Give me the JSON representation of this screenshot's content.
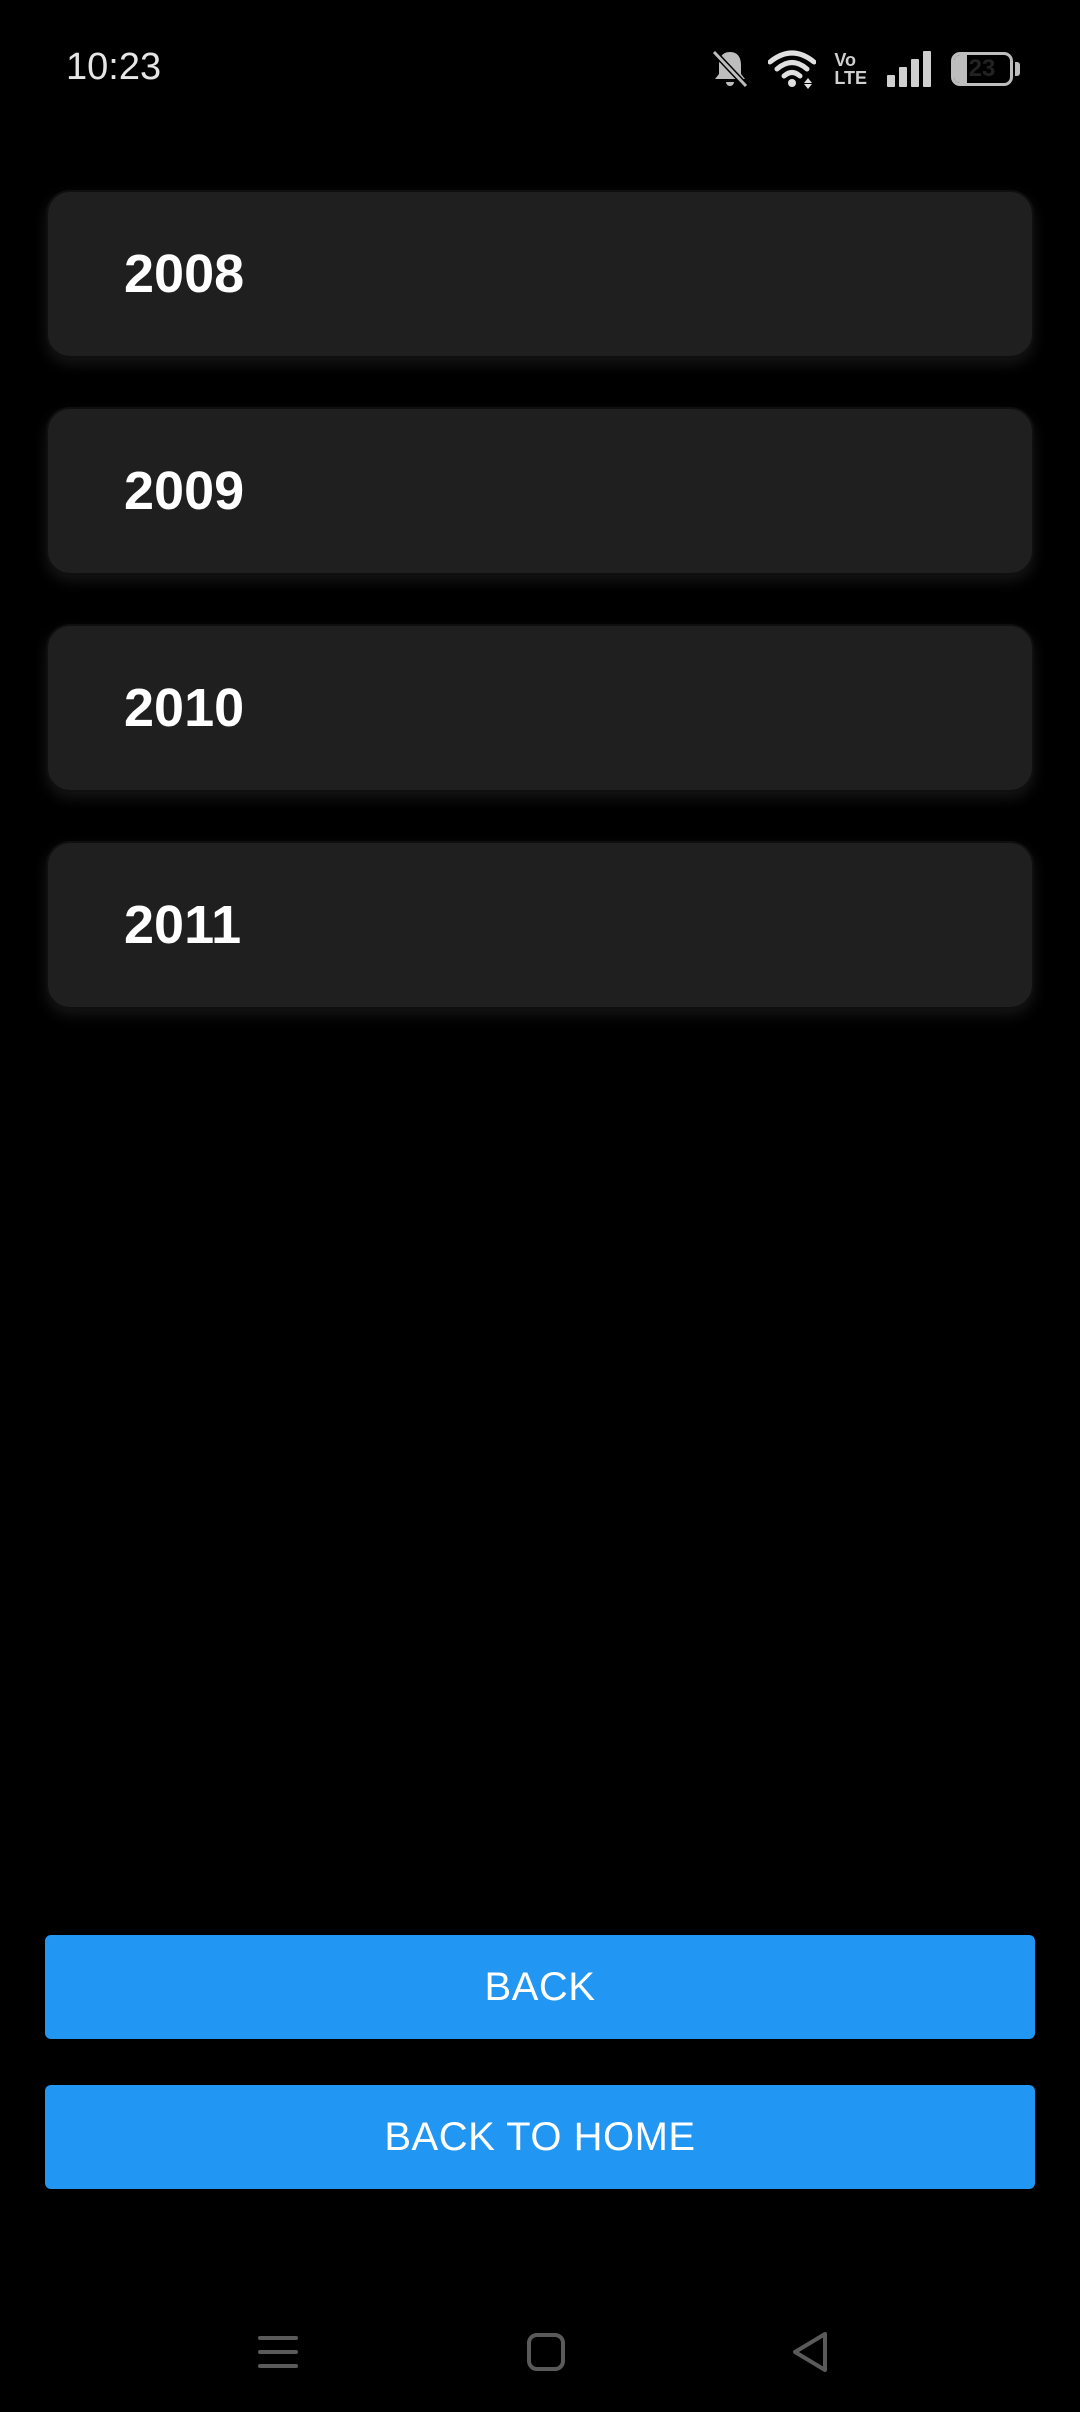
{
  "status_bar": {
    "time": "10:23",
    "battery_level": "23",
    "icons": [
      "bell-muted-icon",
      "wifi-icon",
      "volte-icon",
      "signal-icon",
      "battery-icon"
    ],
    "volte_top": "Vo",
    "volte_bottom": "LTE"
  },
  "years": {
    "items": [
      {
        "label": "2008"
      },
      {
        "label": "2009"
      },
      {
        "label": "2010"
      },
      {
        "label": "2011"
      }
    ]
  },
  "buttons": {
    "back_label": "BACK",
    "home_label": "BACK TO HOME"
  },
  "nav_bar": {
    "icons": [
      "menu-icon",
      "home-icon",
      "back-icon"
    ]
  },
  "colors": {
    "background": "#000000",
    "card": "#1f1f1f",
    "accent": "#2196f3",
    "text": "#ffffff"
  }
}
